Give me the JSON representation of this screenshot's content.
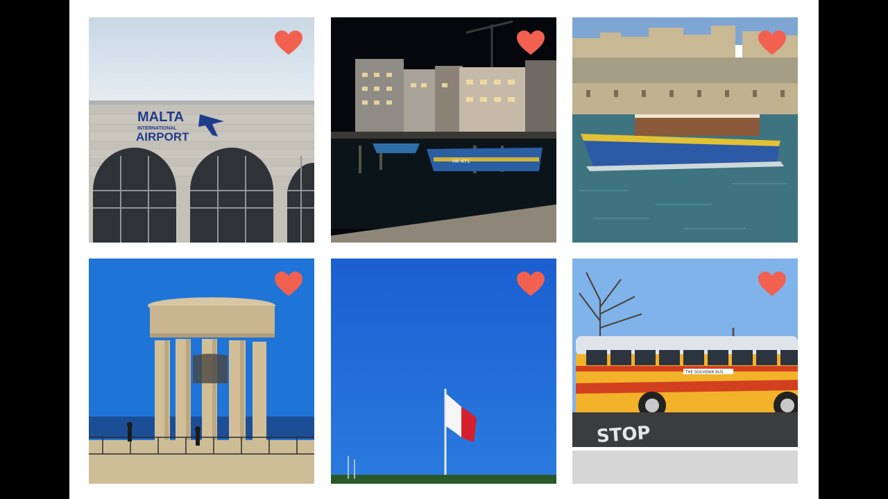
{
  "gallery": {
    "tiles": [
      {
        "sign_line1": "MALTA",
        "sign_line2": "INTERNATIONAL",
        "sign_line3": "AIRPORT",
        "favorited": true
      },
      {
        "boat_text": "HK 471",
        "favorited": true
      },
      {
        "favorited": true
      },
      {
        "favorited": true
      },
      {
        "favorited": true
      },
      {
        "bus_sign": "THE SOUVENIR BUS",
        "road_text": "STOP",
        "favorited": true
      }
    ]
  },
  "colors": {
    "heart": "#f26150",
    "panel": "#ffffff",
    "frame": "#000000"
  },
  "icons": {
    "favorite": "heart-icon"
  }
}
